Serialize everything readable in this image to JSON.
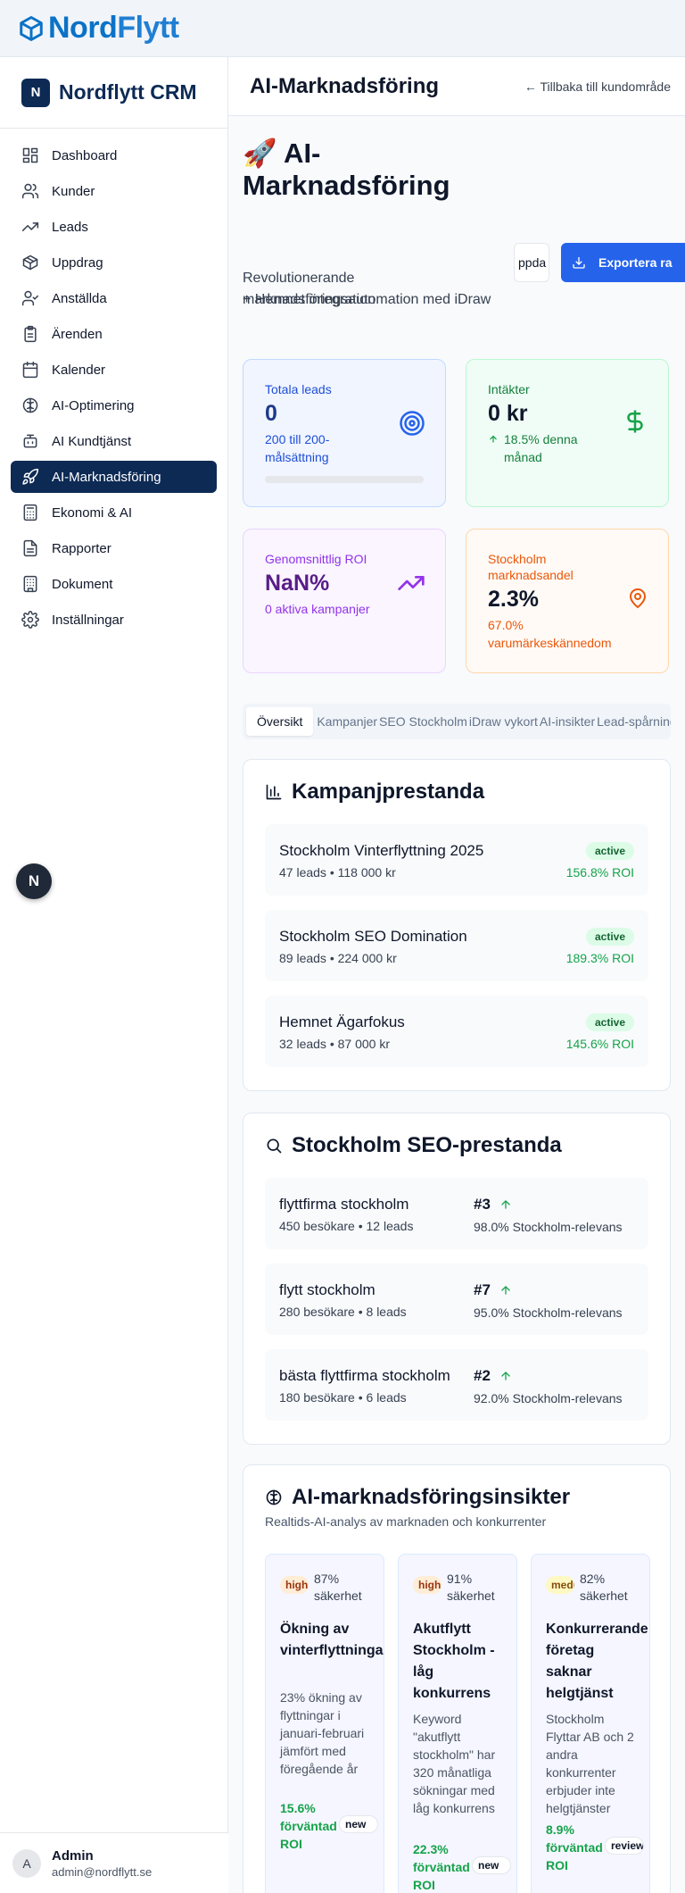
{
  "brand": {
    "logo_part1": "Nord",
    "logo_part2": "Flytt",
    "crm_badge": "N",
    "crm_title": "Nordflytt CRM"
  },
  "sidebar": {
    "items": [
      {
        "label": "Dashboard",
        "icon": "grid-icon"
      },
      {
        "label": "Kunder",
        "icon": "users-icon"
      },
      {
        "label": "Leads",
        "icon": "trending-up-icon"
      },
      {
        "label": "Uppdrag",
        "icon": "package-icon"
      },
      {
        "label": "Anställda",
        "icon": "user-check-icon"
      },
      {
        "label": "Ärenden",
        "icon": "clipboard-icon"
      },
      {
        "label": "Kalender",
        "icon": "calendar-icon"
      },
      {
        "label": "AI-Optimering",
        "icon": "brain-icon"
      },
      {
        "label": "AI Kundtjänst",
        "icon": "bot-icon"
      },
      {
        "label": "AI-Marknadsföring",
        "icon": "rocket-icon",
        "active": true
      },
      {
        "label": "Ekonomi & AI",
        "icon": "calculator-icon"
      },
      {
        "label": "Rapporter",
        "icon": "file-text-icon"
      },
      {
        "label": "Dokument",
        "icon": "file-icon"
      },
      {
        "label": "Inställningar",
        "icon": "settings-icon"
      }
    ],
    "floating_badge": "N",
    "user": {
      "initial": "A",
      "name": "Admin",
      "email": "admin@nordflytt.se"
    }
  },
  "header": {
    "title": "AI-Marknadsföring",
    "back_link": "← Tillbaka till kundområde"
  },
  "hero": {
    "title": "🚀 AI-Marknadsföring",
    "subtitle_line1": "Revolutionerande marknadsföringsautomation med iDraw",
    "subtitle_line2": "+ Hemnet integration",
    "update_button": "ppda",
    "export_button": "Exportera ra"
  },
  "stats": {
    "total_leads": {
      "label": "Totala leads",
      "value": "0",
      "sub": "200 till 200-målsättning",
      "progress": 0
    },
    "revenue": {
      "label": "Intäkter",
      "value": "0 kr",
      "sub": "18.5% denna månad"
    },
    "avg_roi": {
      "label": "Genomsnittlig ROI",
      "value": "NaN%",
      "sub": "0 aktiva kampanjer"
    },
    "market_share": {
      "label": "Stockholm marknadsandel",
      "value": "2.3%",
      "sub": "67.0% varumärkeskännedom"
    }
  },
  "tabs": [
    "Översikt",
    "Kampanjer",
    "SEO Stockholm",
    "iDraw vykort",
    "AI-insikter",
    "Lead-spårning"
  ],
  "campaigns": {
    "title": "Kampanjprestanda",
    "items": [
      {
        "name": "Stockholm Vinterflyttning 2025",
        "meta": "47 leads • 118 000 kr",
        "status": "active",
        "roi": "156.8% ROI"
      },
      {
        "name": "Stockholm SEO Domination",
        "meta": "89 leads • 224 000 kr",
        "status": "active",
        "roi": "189.3% ROI"
      },
      {
        "name": "Hemnet Ägarfokus",
        "meta": "32 leads • 87 000 kr",
        "status": "active",
        "roi": "145.6% ROI"
      }
    ]
  },
  "seo": {
    "title": "Stockholm SEO-prestanda",
    "items": [
      {
        "keyword": "flyttfirma stockholm",
        "meta": "450 besökare • 12 leads",
        "rank": "#3",
        "relevance": "98.0% Stockholm-relevans"
      },
      {
        "keyword": "flytt stockholm",
        "meta": "280 besökare • 8 leads",
        "rank": "#7",
        "relevance": "95.0% Stockholm-relevans"
      },
      {
        "keyword": "bästa flyttfirma stockholm",
        "meta": "180 besökare • 6 leads",
        "rank": "#2",
        "relevance": "92.0% Stockholm-relevans"
      }
    ]
  },
  "insights": {
    "title": "AI-marknadsföringsinsikter",
    "subtitle": "Realtids-AI-analys av marknaden och konkurrenter",
    "items": [
      {
        "priority": "high",
        "confidence": "87% säkerhet",
        "title": "Ökning av vinterflyttningar",
        "description": "23% ökning av flyttningar i januari-februari jämfört med föregående år",
        "roi": "15.6% förväntad ROI",
        "status": "new"
      },
      {
        "priority": "high",
        "confidence": "91% säkerhet",
        "title": "Akutflytt Stockholm - låg konkurrens",
        "description": "Keyword \"akutflytt stockholm\" har 320 månatliga sökningar med låg konkurrens",
        "roi": "22.3% förväntad ROI",
        "status": "new"
      },
      {
        "priority": "medium",
        "confidence": "82% säkerhet",
        "title": "Konkurrerande företag saknar helgtjänst",
        "description": "Stockholm Flyttar AB och 2 andra konkurrenter erbjuder inte helgtjänster",
        "roi": "8.9% förväntad ROI",
        "status": "reviewed"
      }
    ]
  },
  "colors": {
    "navy": "#0d2a55",
    "primary": "#2563eb",
    "success": "#16a34a",
    "purple": "#9333ea",
    "orange": "#ea580c"
  }
}
